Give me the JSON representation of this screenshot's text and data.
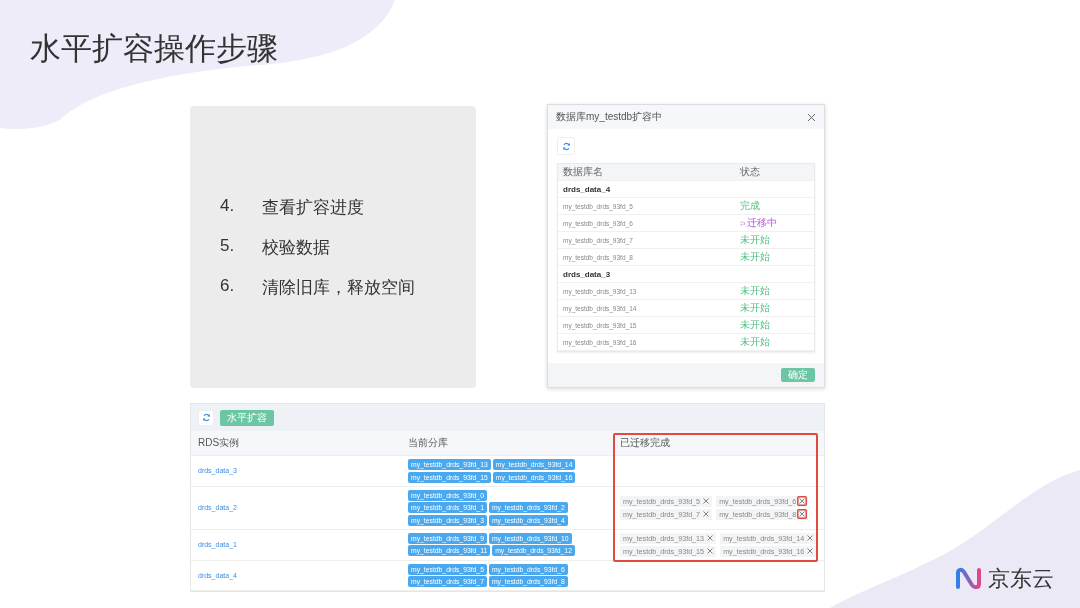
{
  "slide": {
    "title": "水平扩容操作步骤"
  },
  "steps": [
    {
      "number": "4.",
      "text": "查看扩容进度"
    },
    {
      "number": "5.",
      "text": "校验数据"
    },
    {
      "number": "6.",
      "text": "清除旧库，释放空间"
    }
  ],
  "dialog": {
    "title": "数据库my_testdb扩容中",
    "columns": [
      "数据库名",
      "状态"
    ],
    "button": "确定",
    "groups": [
      {
        "name": "drds_data_4",
        "rows": [
          {
            "name": "my_testdb_drds_93fd_5",
            "status": "完成",
            "kind": "done"
          },
          {
            "name": "my_testdb_drds_93fd_6",
            "status": "迁移中",
            "kind": "migrating"
          },
          {
            "name": "my_testdb_drds_93fd_7",
            "status": "未开始",
            "kind": "pending"
          },
          {
            "name": "my_testdb_drds_93fd_8",
            "status": "未开始",
            "kind": "pending"
          }
        ]
      },
      {
        "name": "drds_data_3",
        "rows": [
          {
            "name": "my_testdb_drds_93fd_13",
            "status": "未开始",
            "kind": "pending"
          },
          {
            "name": "my_testdb_drds_93fd_14",
            "status": "未开始",
            "kind": "pending"
          },
          {
            "name": "my_testdb_drds_93fd_15",
            "status": "未开始",
            "kind": "pending"
          },
          {
            "name": "my_testdb_drds_93fd_16",
            "status": "未开始",
            "kind": "pending"
          }
        ]
      }
    ]
  },
  "panel": {
    "button": "水平扩容",
    "columns": [
      "RDS实例",
      "当前分库",
      "已迁移完成"
    ],
    "rows": [
      {
        "instance": "drds_data_3",
        "current": [
          [
            "my_testdb_drds_93fd_13",
            "my_testdb_drds_93fd_14"
          ],
          [
            "my_testdb_drds_93fd_15",
            "my_testdb_drds_93fd_16"
          ]
        ],
        "migrated": []
      },
      {
        "instance": "drds_data_2",
        "current": [
          [
            "my_testdb_drds_93fd_0"
          ],
          [
            "my_testdb_drds_93fd_1",
            "my_testdb_drds_93fd_2"
          ],
          [
            "my_testdb_drds_93fd_3",
            "my_testdb_drds_93fd_4"
          ]
        ],
        "migrated": [
          {
            "name": "my_testdb_drds_93fd_5",
            "highlighted": false
          },
          {
            "name": "my_testdb_drds_93fd_6",
            "highlighted": true
          },
          {
            "name": "my_testdb_drds_93fd_7",
            "highlighted": false
          },
          {
            "name": "my_testdb_drds_93fd_8",
            "highlighted": true
          }
        ]
      },
      {
        "instance": "drds_data_1",
        "current": [
          [
            "my_testdb_drds_93fd_9",
            "my_testdb_drds_93fd_10"
          ],
          [
            "my_testdb_drds_93fd_11",
            "my_testdb_drds_93fd_12"
          ]
        ],
        "migrated": [
          {
            "name": "my_testdb_drds_93fd_13",
            "highlighted": false
          },
          {
            "name": "my_testdb_drds_93fd_14",
            "highlighted": false
          },
          {
            "name": "my_testdb_drds_93fd_15",
            "highlighted": false
          },
          {
            "name": "my_testdb_drds_93fd_16",
            "highlighted": false
          }
        ]
      },
      {
        "instance": "drds_data_4",
        "current": [
          [
            "my_testdb_drds_93fd_5",
            "my_testdb_drds_93fd_6"
          ],
          [
            "my_testdb_drds_93fd_7",
            "my_testdb_drds_93fd_8"
          ]
        ],
        "migrated": []
      }
    ]
  },
  "logo": {
    "text": "京东云"
  }
}
